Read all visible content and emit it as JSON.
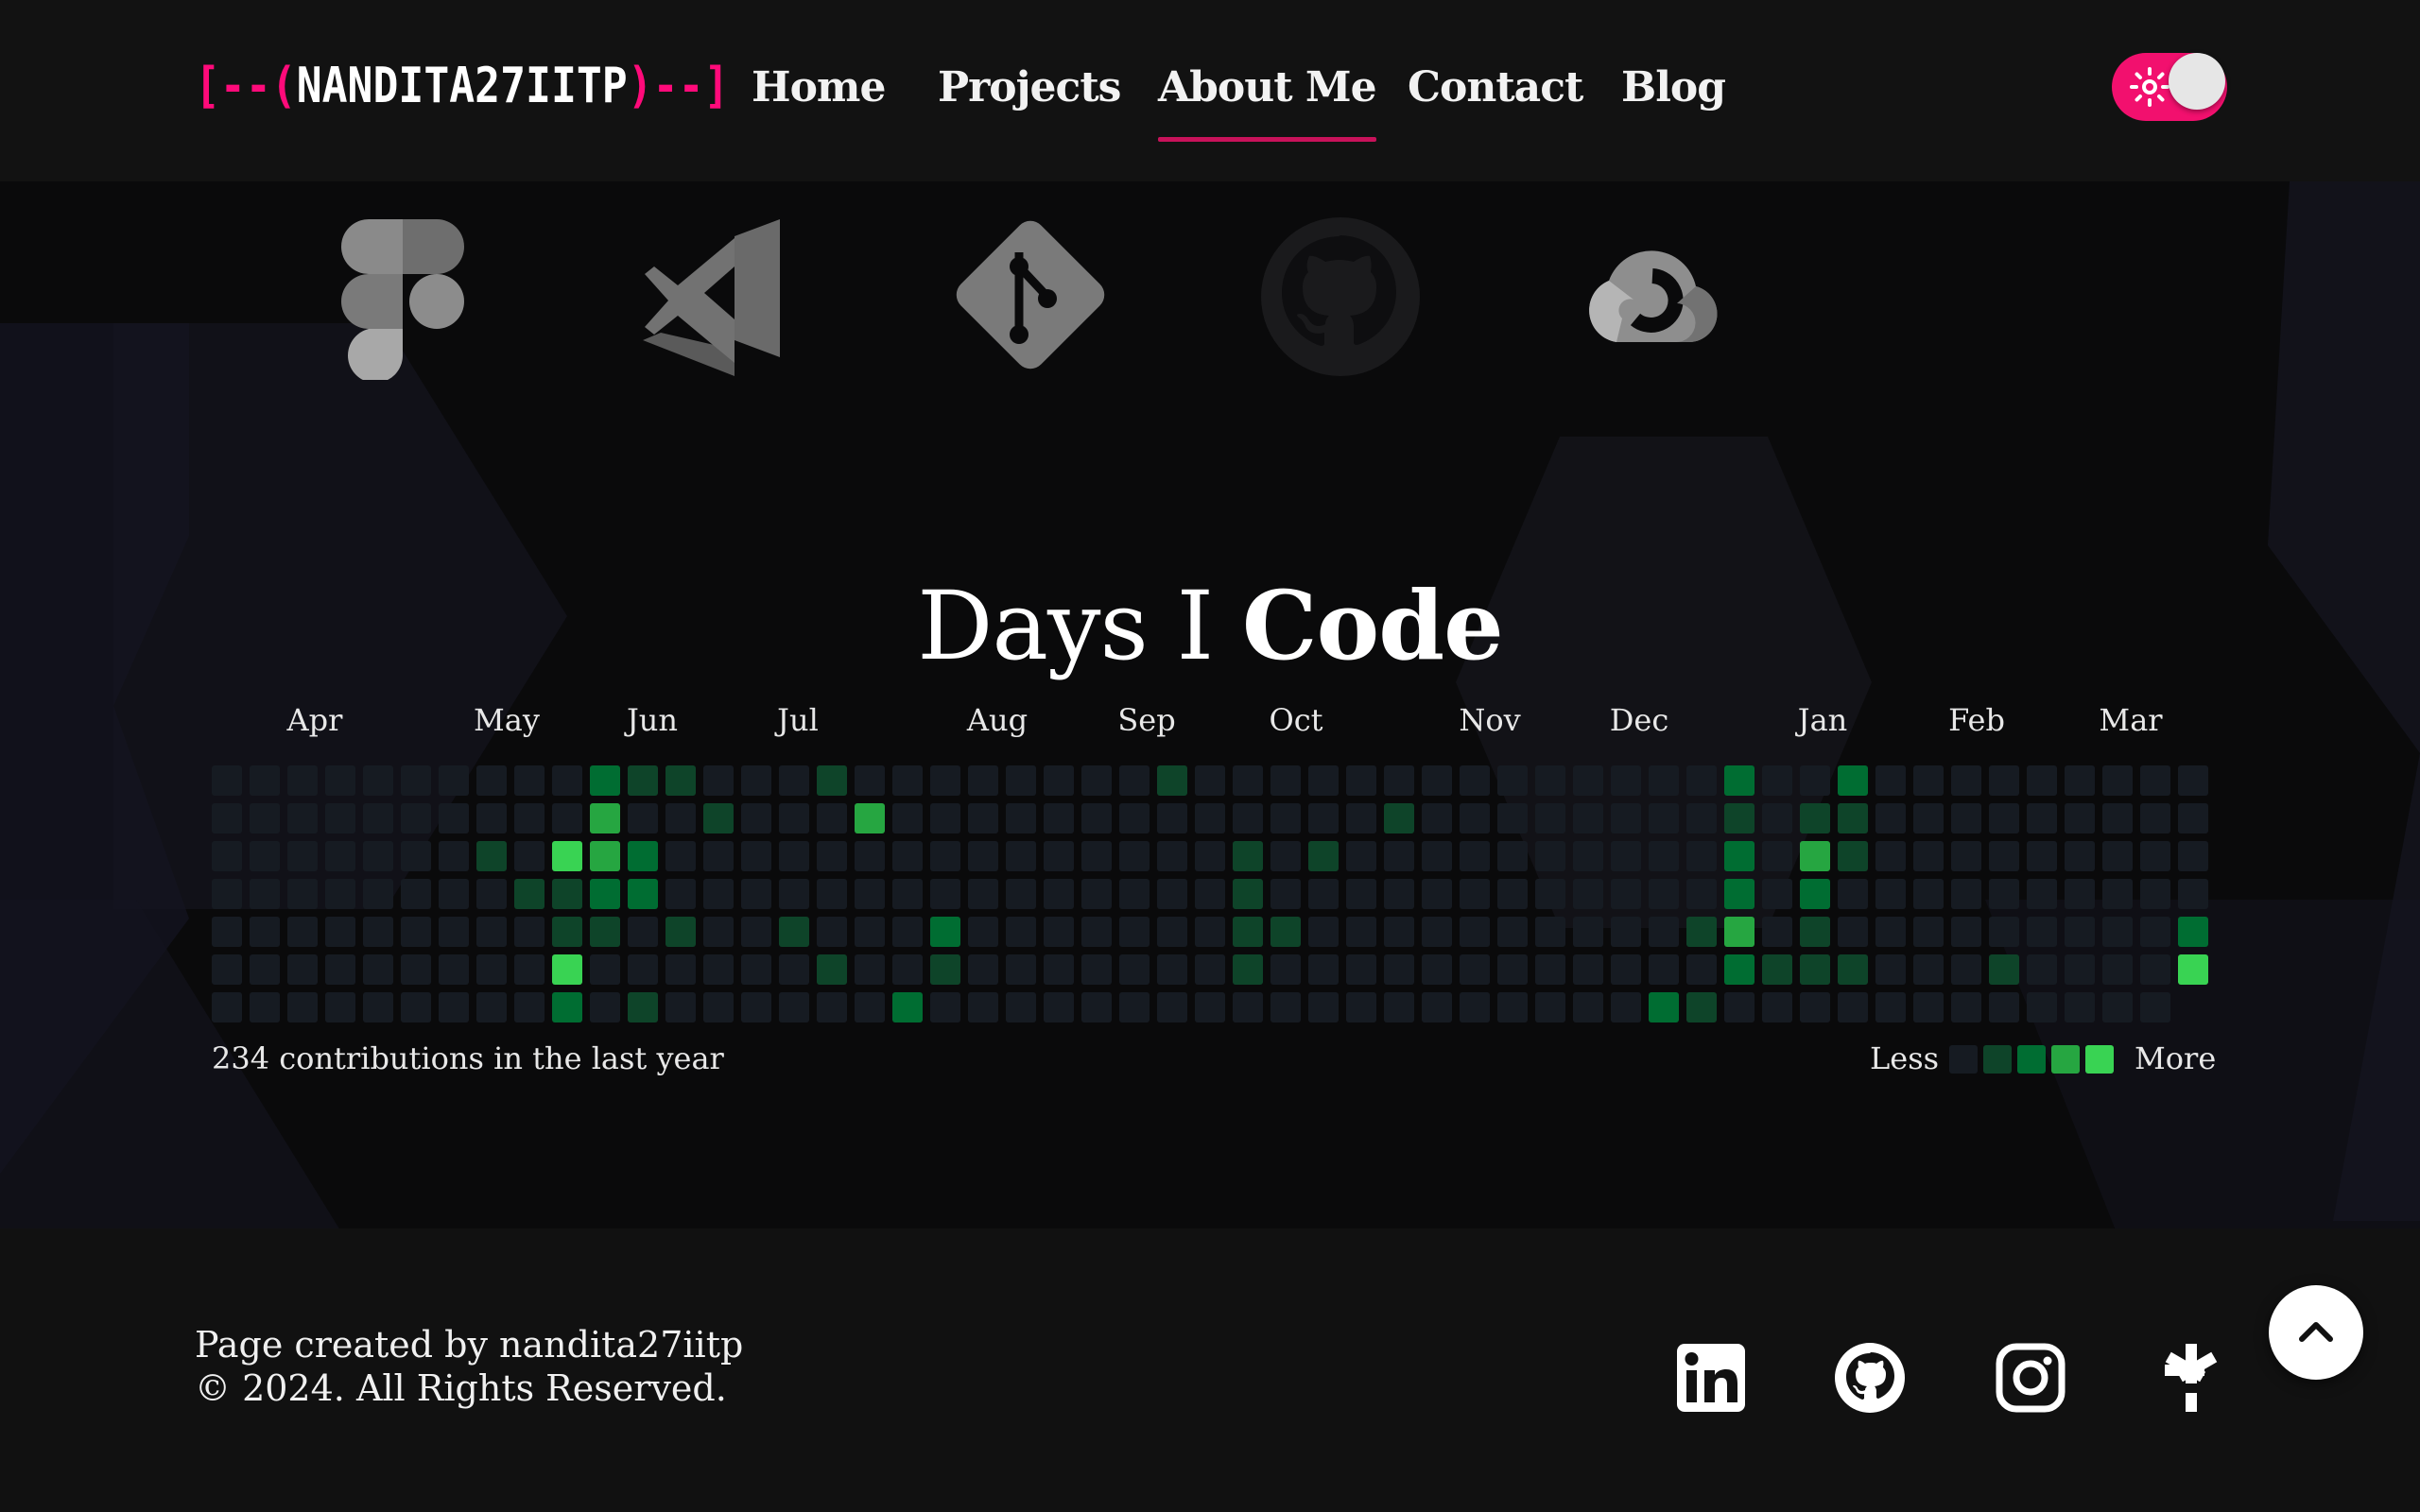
{
  "header": {
    "logo": {
      "bracket_open": "[--(",
      "name": "NANDITA27IITP",
      "bracket_close": ")--]"
    },
    "nav": [
      {
        "label": "Home",
        "active": false
      },
      {
        "label": "Projects",
        "active": false
      },
      {
        "label": "About Me",
        "active": true
      },
      {
        "label": "Contact",
        "active": false
      },
      {
        "label": "Blog",
        "active": false
      }
    ],
    "theme_toggle": {
      "icon": "sun-icon",
      "state": "on"
    }
  },
  "skills": {
    "icons": [
      "figma-icon",
      "visual-studio-icon",
      "git-icon",
      "github-icon",
      "google-cloud-icon"
    ]
  },
  "contributions": {
    "heading_light": "Days I",
    "heading_bold": "Code",
    "months": [
      "Apr",
      "May",
      "Jun",
      "Jul",
      "Aug",
      "Sep",
      "Oct",
      "Nov",
      "Dec",
      "Jan",
      "Feb",
      "Mar"
    ],
    "summary": "234 contributions in the last year",
    "legend_less": "Less",
    "legend_more": "More",
    "level_colors": [
      "#161b22",
      "#0e4429",
      "#006d32",
      "#26a641",
      "#39d353"
    ],
    "weeks": [
      [
        0,
        0,
        0,
        0,
        0,
        0,
        0
      ],
      [
        0,
        0,
        0,
        0,
        0,
        0,
        0
      ],
      [
        0,
        0,
        0,
        0,
        0,
        0,
        0
      ],
      [
        0,
        0,
        0,
        0,
        0,
        0,
        0
      ],
      [
        0,
        0,
        0,
        0,
        0,
        0,
        0
      ],
      [
        0,
        0,
        0,
        0,
        0,
        0,
        0
      ],
      [
        0,
        0,
        0,
        0,
        0,
        0,
        0
      ],
      [
        0,
        0,
        1,
        0,
        0,
        0,
        0
      ],
      [
        0,
        0,
        0,
        1,
        0,
        0,
        0
      ],
      [
        0,
        0,
        4,
        1,
        1,
        4,
        2
      ],
      [
        2,
        3,
        3,
        2,
        1,
        0,
        0
      ],
      [
        1,
        0,
        2,
        2,
        0,
        0,
        1
      ],
      [
        1,
        0,
        0,
        0,
        1,
        0,
        0
      ],
      [
        0,
        1,
        0,
        0,
        0,
        0,
        0
      ],
      [
        0,
        0,
        0,
        0,
        0,
        0,
        0
      ],
      [
        0,
        0,
        0,
        0,
        1,
        0,
        0
      ],
      [
        1,
        0,
        0,
        0,
        0,
        1,
        0
      ],
      [
        0,
        3,
        0,
        0,
        0,
        0,
        0
      ],
      [
        0,
        0,
        0,
        0,
        0,
        0,
        2
      ],
      [
        0,
        0,
        0,
        0,
        2,
        1,
        0
      ],
      [
        0,
        0,
        0,
        0,
        0,
        0,
        0
      ],
      [
        0,
        0,
        0,
        0,
        0,
        0,
        0
      ],
      [
        0,
        0,
        0,
        0,
        0,
        0,
        0
      ],
      [
        0,
        0,
        0,
        0,
        0,
        0,
        0
      ],
      [
        0,
        0,
        0,
        0,
        0,
        0,
        0
      ],
      [
        1,
        0,
        0,
        0,
        0,
        0,
        0
      ],
      [
        0,
        0,
        0,
        0,
        0,
        0,
        0
      ],
      [
        0,
        0,
        1,
        1,
        1,
        1,
        0
      ],
      [
        0,
        0,
        0,
        0,
        1,
        0,
        0
      ],
      [
        0,
        0,
        1,
        0,
        0,
        0,
        0
      ],
      [
        0,
        0,
        0,
        0,
        0,
        0,
        0
      ],
      [
        0,
        1,
        0,
        0,
        0,
        0,
        0
      ],
      [
        0,
        0,
        0,
        0,
        0,
        0,
        0
      ],
      [
        0,
        0,
        0,
        0,
        0,
        0,
        0
      ],
      [
        0,
        0,
        0,
        0,
        0,
        0,
        0
      ],
      [
        0,
        0,
        0,
        0,
        0,
        0,
        0
      ],
      [
        0,
        0,
        0,
        0,
        0,
        0,
        0
      ],
      [
        0,
        0,
        0,
        0,
        0,
        0,
        0
      ],
      [
        0,
        0,
        0,
        0,
        0,
        0,
        2
      ],
      [
        0,
        0,
        0,
        0,
        1,
        0,
        1
      ],
      [
        2,
        1,
        2,
        2,
        3,
        2,
        0
      ],
      [
        0,
        0,
        0,
        0,
        0,
        1,
        0
      ],
      [
        0,
        1,
        3,
        2,
        1,
        1,
        0
      ],
      [
        2,
        1,
        1,
        0,
        0,
        1,
        0
      ],
      [
        0,
        0,
        0,
        0,
        0,
        0,
        0
      ],
      [
        0,
        0,
        0,
        0,
        0,
        0,
        0
      ],
      [
        0,
        0,
        0,
        0,
        0,
        0,
        0
      ],
      [
        0,
        0,
        0,
        0,
        0,
        1,
        0
      ],
      [
        0,
        0,
        0,
        0,
        0,
        0,
        0
      ],
      [
        0,
        0,
        0,
        0,
        0,
        0,
        0
      ],
      [
        0,
        0,
        0,
        0,
        0,
        0,
        0
      ],
      [
        0,
        0,
        0,
        0,
        0,
        0,
        0
      ],
      [
        0,
        0,
        0,
        0,
        2,
        4
      ]
    ]
  },
  "footer": {
    "credit_line1": "Page created by nandita27iitp",
    "credit_line2": "© 2024. All Rights Reserved.",
    "social": [
      "linkedin-icon",
      "github-icon",
      "instagram-icon",
      "linktree-icon"
    ],
    "back_to_top_icon": "chevron-up-icon"
  }
}
